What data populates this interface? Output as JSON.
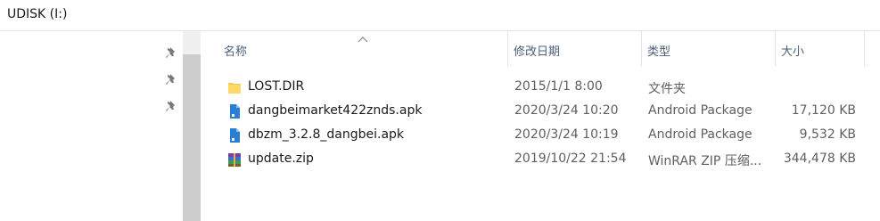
{
  "address": {
    "path": "UDISK (I:)"
  },
  "icons": {
    "pin": "pin-icon",
    "folder": "folder-icon",
    "apk": "apk-file-icon",
    "zip": "winrar-archive-icon"
  },
  "colors": {
    "header_text": "#4c607a",
    "folder": "#f4c84e",
    "apk": "#2a7fd4"
  },
  "columns": {
    "name": "名称",
    "date": "修改日期",
    "type": "类型",
    "size": "大小"
  },
  "files": [
    {
      "name": "LOST.DIR",
      "date": "2015/1/1 8:00",
      "type": "文件夹",
      "size": "",
      "icon": "folder-icon"
    },
    {
      "name": "dangbeimarket422znds.apk",
      "date": "2020/3/24 10:20",
      "type": "Android Package",
      "size": "17,120 KB",
      "icon": "apk-file-icon"
    },
    {
      "name": "dbzm_3.2.8_dangbei.apk",
      "date": "2020/3/24 10:19",
      "type": "Android Package",
      "size": "9,532 KB",
      "icon": "apk-file-icon"
    },
    {
      "name": "update.zip",
      "date": "2019/10/22 21:54",
      "type": "WinRAR ZIP 压缩...",
      "size": "344,478 KB",
      "icon": "winrar-archive-icon"
    }
  ]
}
